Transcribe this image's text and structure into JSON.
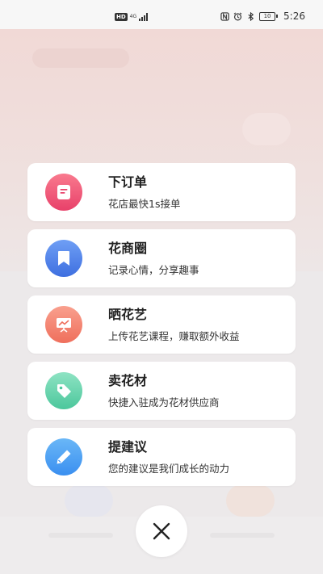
{
  "status_bar": {
    "hd": "HD",
    "network": "4G",
    "network_sub": "4G",
    "battery": "10",
    "time": "5:26"
  },
  "menu": {
    "items": [
      {
        "title": "下订单",
        "subtitle": "花店最快1s接单",
        "icon": "order-icon",
        "color_top": "#f97a8e",
        "color_bottom": "#e8416a"
      },
      {
        "title": "花商圈",
        "subtitle": "记录心情，分享趣事",
        "icon": "bookmark-icon",
        "color_top": "#6f9ff5",
        "color_bottom": "#3e6fe0"
      },
      {
        "title": "晒花艺",
        "subtitle": "上传花艺课程，赚取额外收益",
        "icon": "presentation-icon",
        "color_top": "#f9a08e",
        "color_bottom": "#ef6f5c"
      },
      {
        "title": "卖花材",
        "subtitle": "快捷入驻成为花材供应商",
        "icon": "price-tag-icon",
        "color_top": "#8ee3c3",
        "color_bottom": "#4cc79c"
      },
      {
        "title": "提建议",
        "subtitle": "您的建议是我们成长的动力",
        "icon": "pencil-icon",
        "color_top": "#6ab7f7",
        "color_bottom": "#3a8ff0"
      }
    ]
  },
  "close": {
    "icon": "close-icon"
  }
}
